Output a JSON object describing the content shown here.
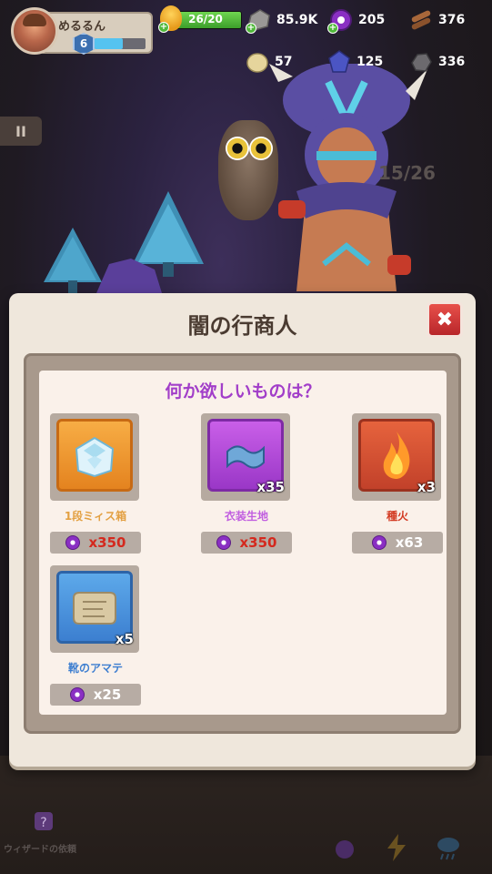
{
  "player": {
    "name": "めるるん",
    "level": "6",
    "xp_fraction": 0.55
  },
  "resources": {
    "energy": "26/20",
    "stone": "85.9K",
    "gems": "205",
    "wood": "376",
    "gold_nugget": "57",
    "crystal": "125",
    "iron": "336"
  },
  "pause_label": "II",
  "scene": {
    "progress": "15/26"
  },
  "dialog": {
    "title": "闇の行商人",
    "question": "何か欲しいものは？",
    "items": [
      {
        "name": "1段ミィス箱",
        "qty": "",
        "price": "x350",
        "affordable": false,
        "icon": "ice-chest-icon",
        "tile": "orange"
      },
      {
        "name": "衣装生地",
        "qty": "x35",
        "price": "x350",
        "affordable": false,
        "icon": "fabric-icon",
        "tile": "purple"
      },
      {
        "name": "種火",
        "qty": "x3",
        "price": "x63",
        "affordable": true,
        "icon": "flame-icon",
        "tile": "red"
      },
      {
        "name": "靴のアマテ",
        "qty": "x5",
        "price": "x25",
        "affordable": true,
        "icon": "scroll-icon",
        "tile": "blue"
      }
    ]
  },
  "bottom": {
    "wizard_label": "ウィザードの依頼"
  },
  "colors": {
    "accent_purple": "#a23ec9",
    "price_red": "#d4291e",
    "close_red": "#d83a38"
  }
}
